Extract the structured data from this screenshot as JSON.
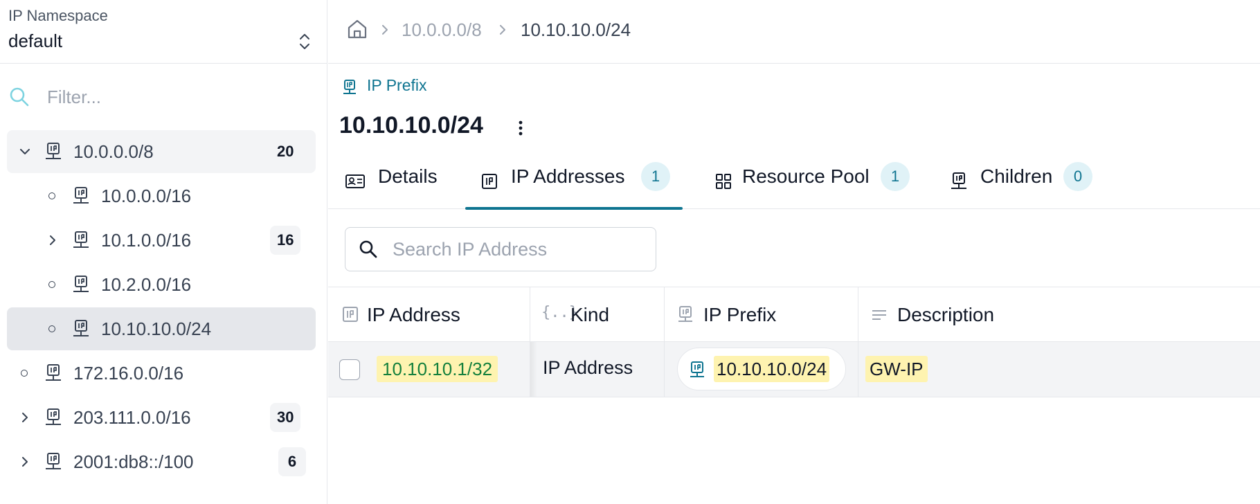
{
  "sidebar": {
    "namespace": {
      "label": "IP Namespace",
      "value": "default"
    },
    "filter": {
      "placeholder": "Filter..."
    },
    "tree": [
      {
        "label": "10.0.0.0/8",
        "count": "20",
        "expanded": true
      },
      {
        "label": "10.0.0.0/16",
        "count": ""
      },
      {
        "label": "10.1.0.0/16",
        "count": "16"
      },
      {
        "label": "10.2.0.0/16",
        "count": ""
      },
      {
        "label": "10.10.10.0/24",
        "count": "",
        "selected": true
      },
      {
        "label": "172.16.0.0/16",
        "count": ""
      },
      {
        "label": "203.111.0.0/16",
        "count": "30"
      },
      {
        "label": "2001:db8::/100",
        "count": "6"
      }
    ]
  },
  "breadcrumb": {
    "home_icon": "home-icon",
    "items": [
      "10.0.0.0/8",
      "10.10.10.0/24"
    ]
  },
  "header": {
    "kind": "IP Prefix",
    "title": "10.10.10.0/24"
  },
  "tabs": [
    {
      "label": "Details",
      "icon": "id-card-icon",
      "count": ""
    },
    {
      "label": "IP Addresses",
      "icon": "ip-icon",
      "count": "1",
      "active": true
    },
    {
      "label": "Resource Pool",
      "icon": "grid-icon",
      "count": "1"
    },
    {
      "label": "Children",
      "icon": "prefix-icon",
      "count": "0"
    }
  ],
  "search": {
    "placeholder": "Search IP Address"
  },
  "table": {
    "columns": [
      {
        "label": "IP Address",
        "icon": "ip-icon"
      },
      {
        "label": "Kind",
        "icon": "braces-icon"
      },
      {
        "label": "IP Prefix",
        "icon": "prefix-icon"
      },
      {
        "label": "Description",
        "icon": "text-lines-icon"
      }
    ],
    "rows": [
      {
        "ip_address": "10.10.10.1/32",
        "kind": "IP Address",
        "ip_prefix": "10.10.10.0/24",
        "description": "GW-IP"
      }
    ]
  },
  "colors": {
    "accent": "#0e7490",
    "highlight": "#fef3b0",
    "selected_row": "#e5e7eb"
  }
}
